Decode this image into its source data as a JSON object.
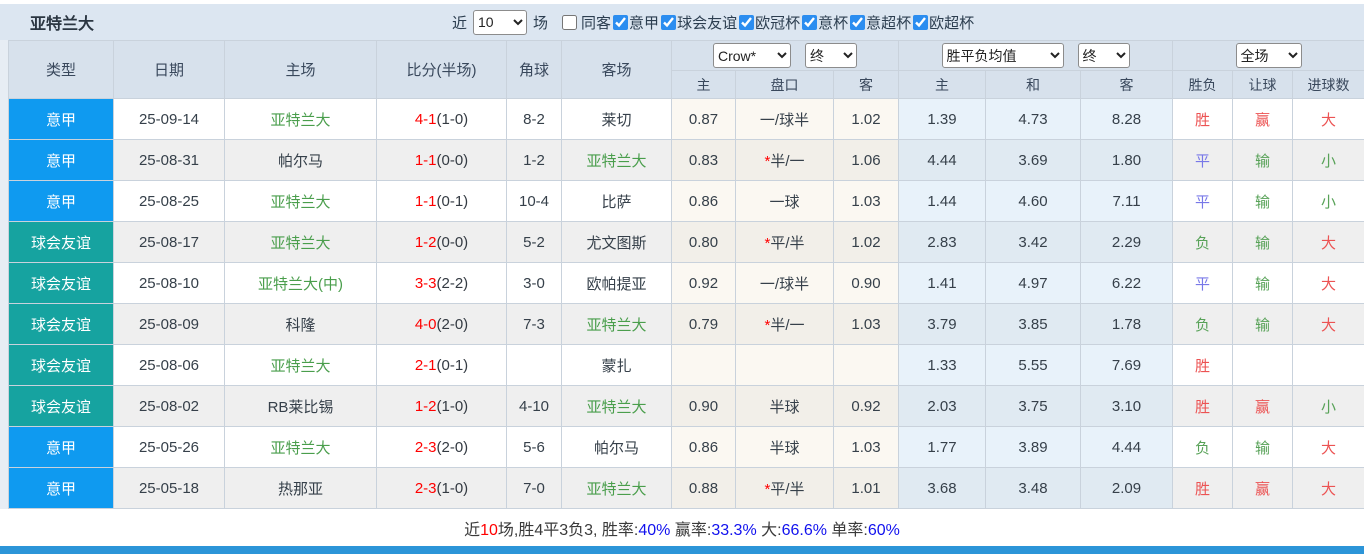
{
  "header": {
    "title": "亚特兰大",
    "recent_label": "近",
    "recent_value": "10",
    "matches_label": "场",
    "same_venue_label": "同客",
    "same_venue_checked": false,
    "competitions": [
      {
        "label": "意甲",
        "checked": true
      },
      {
        "label": "球会友谊",
        "checked": true
      },
      {
        "label": "欧冠杯",
        "checked": true
      },
      {
        "label": "意杯",
        "checked": true
      },
      {
        "label": "意超杯",
        "checked": true
      },
      {
        "label": "欧超杯",
        "checked": true
      }
    ]
  },
  "table": {
    "main_columns": [
      "类型",
      "日期",
      "主场",
      "比分(半场)",
      "角球",
      "客场"
    ],
    "ah_group": {
      "bookmaker": "Crow*",
      "time": "终",
      "subs": [
        "主",
        "盘口",
        "客"
      ]
    },
    "avg_group": {
      "label": "胜平负均值",
      "time": "终",
      "subs": [
        "主",
        "和",
        "客"
      ]
    },
    "result_group": {
      "scope": "全场",
      "subs": [
        "胜负",
        "让球",
        "进球数"
      ]
    },
    "rows": [
      {
        "type": "意甲",
        "type_class": "league",
        "date": "25-09-14",
        "home": "亚特兰大",
        "home_self": true,
        "score_ft": "4-1",
        "score_ht": "(1-0)",
        "corners": "8-2",
        "away": "莱切",
        "away_self": false,
        "ah_home": "0.87",
        "ah_star": false,
        "ah_line": "一/球半",
        "ah_away": "1.02",
        "avg_home": "1.39",
        "avg_draw": "4.73",
        "avg_away": "8.28",
        "result": {
          "text": "胜",
          "color": "red"
        },
        "handicap": {
          "text": "赢",
          "color": "red"
        },
        "goals": {
          "text": "大",
          "color": "red"
        }
      },
      {
        "type": "意甲",
        "type_class": "league",
        "date": "25-08-31",
        "home": "帕尔马",
        "home_self": false,
        "score_ft": "1-1",
        "score_ht": "(0-0)",
        "corners": "1-2",
        "away": "亚特兰大",
        "away_self": true,
        "ah_home": "0.83",
        "ah_star": true,
        "ah_line": "半/一",
        "ah_away": "1.06",
        "avg_home": "4.44",
        "avg_draw": "3.69",
        "avg_away": "1.80",
        "result": {
          "text": "平",
          "color": "blue"
        },
        "handicap": {
          "text": "输",
          "color": "green"
        },
        "goals": {
          "text": "小",
          "color": "green"
        }
      },
      {
        "type": "意甲",
        "type_class": "league",
        "date": "25-08-25",
        "home": "亚特兰大",
        "home_self": true,
        "score_ft": "1-1",
        "score_ht": "(0-1)",
        "corners": "10-4",
        "away": "比萨",
        "away_self": false,
        "ah_home": "0.86",
        "ah_star": false,
        "ah_line": "一球",
        "ah_away": "1.03",
        "avg_home": "1.44",
        "avg_draw": "4.60",
        "avg_away": "7.11",
        "result": {
          "text": "平",
          "color": "blue"
        },
        "handicap": {
          "text": "输",
          "color": "green"
        },
        "goals": {
          "text": "小",
          "color": "green"
        }
      },
      {
        "type": "球会友谊",
        "type_class": "friendly",
        "date": "25-08-17",
        "home": "亚特兰大",
        "home_self": true,
        "score_ft": "1-2",
        "score_ht": "(0-0)",
        "corners": "5-2",
        "away": "尤文图斯",
        "away_self": false,
        "ah_home": "0.80",
        "ah_star": true,
        "ah_line": "平/半",
        "ah_away": "1.02",
        "avg_home": "2.83",
        "avg_draw": "3.42",
        "avg_away": "2.29",
        "result": {
          "text": "负",
          "color": "green"
        },
        "handicap": {
          "text": "输",
          "color": "green"
        },
        "goals": {
          "text": "大",
          "color": "red"
        }
      },
      {
        "type": "球会友谊",
        "type_class": "friendly",
        "date": "25-08-10",
        "home": "亚特兰大(中)",
        "home_self": true,
        "score_ft": "3-3",
        "score_ht": "(2-2)",
        "corners": "3-0",
        "away": "欧帕提亚",
        "away_self": false,
        "ah_home": "0.92",
        "ah_star": false,
        "ah_line": "一/球半",
        "ah_away": "0.90",
        "avg_home": "1.41",
        "avg_draw": "4.97",
        "avg_away": "6.22",
        "result": {
          "text": "平",
          "color": "blue"
        },
        "handicap": {
          "text": "输",
          "color": "green"
        },
        "goals": {
          "text": "大",
          "color": "red"
        }
      },
      {
        "type": "球会友谊",
        "type_class": "friendly",
        "date": "25-08-09",
        "home": "科隆",
        "home_self": false,
        "score_ft": "4-0",
        "score_ht": "(2-0)",
        "corners": "7-3",
        "away": "亚特兰大",
        "away_self": true,
        "ah_home": "0.79",
        "ah_star": true,
        "ah_line": "半/一",
        "ah_away": "1.03",
        "avg_home": "3.79",
        "avg_draw": "3.85",
        "avg_away": "1.78",
        "result": {
          "text": "负",
          "color": "green"
        },
        "handicap": {
          "text": "输",
          "color": "green"
        },
        "goals": {
          "text": "大",
          "color": "red"
        }
      },
      {
        "type": "球会友谊",
        "type_class": "friendly",
        "date": "25-08-06",
        "home": "亚特兰大",
        "home_self": true,
        "score_ft": "2-1",
        "score_ht": "(0-1)",
        "corners": "",
        "away": "蒙扎",
        "away_self": false,
        "ah_home": "",
        "ah_star": false,
        "ah_line": "",
        "ah_away": "",
        "avg_home": "1.33",
        "avg_draw": "5.55",
        "avg_away": "7.69",
        "result": {
          "text": "胜",
          "color": "red"
        },
        "handicap": {
          "text": "",
          "color": ""
        },
        "goals": {
          "text": "",
          "color": ""
        }
      },
      {
        "type": "球会友谊",
        "type_class": "friendly",
        "date": "25-08-02",
        "home": "RB莱比锡",
        "home_self": false,
        "score_ft": "1-2",
        "score_ht": "(1-0)",
        "corners": "4-10",
        "away": "亚特兰大",
        "away_self": true,
        "ah_home": "0.90",
        "ah_star": false,
        "ah_line": "半球",
        "ah_away": "0.92",
        "avg_home": "2.03",
        "avg_draw": "3.75",
        "avg_away": "3.10",
        "result": {
          "text": "胜",
          "color": "red"
        },
        "handicap": {
          "text": "赢",
          "color": "red"
        },
        "goals": {
          "text": "小",
          "color": "green"
        }
      },
      {
        "type": "意甲",
        "type_class": "league",
        "date": "25-05-26",
        "home": "亚特兰大",
        "home_self": true,
        "score_ft": "2-3",
        "score_ht": "(2-0)",
        "corners": "5-6",
        "away": "帕尔马",
        "away_self": false,
        "ah_home": "0.86",
        "ah_star": false,
        "ah_line": "半球",
        "ah_away": "1.03",
        "avg_home": "1.77",
        "avg_draw": "3.89",
        "avg_away": "4.44",
        "result": {
          "text": "负",
          "color": "green"
        },
        "handicap": {
          "text": "输",
          "color": "green"
        },
        "goals": {
          "text": "大",
          "color": "red"
        }
      },
      {
        "type": "意甲",
        "type_class": "league",
        "date": "25-05-18",
        "home": "热那亚",
        "home_self": false,
        "score_ft": "2-3",
        "score_ht": "(1-0)",
        "corners": "7-0",
        "away": "亚特兰大",
        "away_self": true,
        "ah_home": "0.88",
        "ah_star": true,
        "ah_line": "平/半",
        "ah_away": "1.01",
        "avg_home": "3.68",
        "avg_draw": "3.48",
        "avg_away": "2.09",
        "result": {
          "text": "胜",
          "color": "red"
        },
        "handicap": {
          "text": "赢",
          "color": "red"
        },
        "goals": {
          "text": "大",
          "color": "red"
        }
      }
    ]
  },
  "summary": {
    "parts": [
      {
        "text": "近",
        "color": "dark"
      },
      {
        "text": "10",
        "color": "red"
      },
      {
        "text": "场,胜4平3负3, 胜率:",
        "color": "dark"
      },
      {
        "text": "40%",
        "color": "blue"
      },
      {
        "text": " 赢率:",
        "color": "dark"
      },
      {
        "text": "33.3%",
        "color": "blue"
      },
      {
        "text": " 大:",
        "color": "dark"
      },
      {
        "text": "66.6%",
        "color": "blue"
      },
      {
        "text": " 单率:",
        "color": "dark"
      },
      {
        "text": "60%",
        "color": "blue"
      }
    ]
  },
  "colors": {
    "league_badge": "#0f9af0",
    "friendly_badge": "#16a3a0",
    "score_red": "#ff0000",
    "team_self_green": "#4a9e4c",
    "result_red": "#ec5353",
    "result_blue": "#7878e8",
    "result_green": "#58a258",
    "summary_blue": "#1111ee",
    "bottom_bar_blue": "#2c95d8"
  }
}
